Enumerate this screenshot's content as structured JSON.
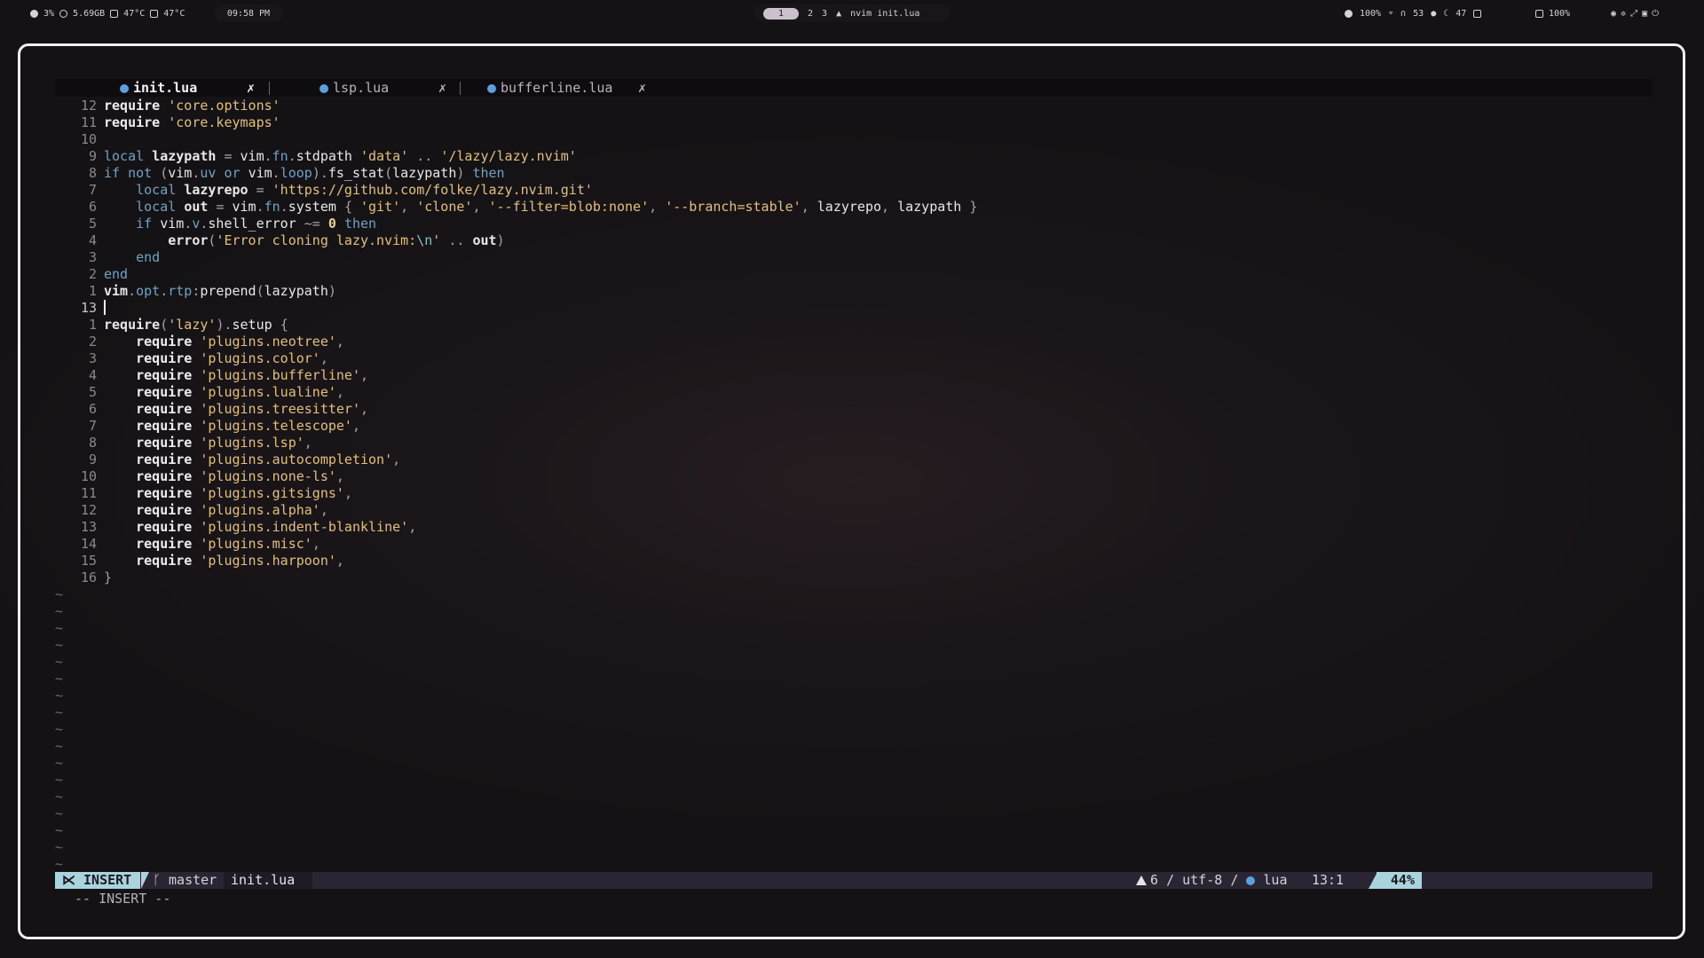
{
  "topbar": {
    "cpu": "3%",
    "mem": "5.69GB",
    "temp1": "47°C",
    "temp2": "47°C",
    "clock": "09:58 PM",
    "workspaces": [
      "1",
      "2",
      "3"
    ],
    "active_window": "nvim init.lua",
    "brightness": "100%",
    "volume": "53",
    "mic_value": "47",
    "battery": "100%"
  },
  "tabs": [
    {
      "label": "init.lua",
      "close": "✗",
      "active": true
    },
    {
      "label": "lsp.lua",
      "close": "✗",
      "active": false
    },
    {
      "label": "bufferline.lua",
      "close": "✗",
      "active": false
    }
  ],
  "line_numbers": [
    "12",
    "11",
    "10",
    "9",
    "8",
    "7",
    "6",
    "5",
    "4",
    "3",
    "2",
    "1",
    "13",
    "1",
    "2",
    "3",
    "4",
    "5",
    "6",
    "7",
    "8",
    "9",
    "10",
    "11",
    "12",
    "13",
    "14",
    "15",
    "16"
  ],
  "code": {
    "l0": [
      "require",
      "'core.options'"
    ],
    "l1": [
      "require",
      "'core.keymaps'"
    ],
    "l3": [
      "local",
      "lazypath",
      "=",
      "vim",
      ".",
      "fn",
      ".",
      "stdpath",
      "'data'",
      "..",
      "'/lazy/lazy.nvim'"
    ],
    "l4": [
      "if",
      "not",
      "(",
      "vim",
      ".",
      "uv",
      "or",
      "vim",
      ".",
      "loop",
      ").",
      "fs_stat",
      "(",
      "lazypath",
      ")",
      "then"
    ],
    "l5": [
      "local",
      "lazyrepo",
      "=",
      "'https://github.com/folke/lazy.nvim.git'"
    ],
    "l6": [
      "local",
      "out",
      "=",
      "vim",
      ".",
      "fn",
      ".",
      "system",
      "{",
      "'git'",
      ",",
      "'clone'",
      ",",
      "'--filter=blob:none'",
      ",",
      "'--branch=stable'",
      ",",
      "lazyrepo",
      ",",
      "lazypath",
      "}"
    ],
    "l7": [
      "if",
      "vim",
      ".",
      "v",
      ".",
      "shell_error",
      "~=",
      "0",
      "then"
    ],
    "l8": [
      "error",
      "(",
      "'Error cloning lazy.nvim:",
      "\\n",
      "'",
      "..",
      "out",
      ")"
    ],
    "l9": [
      "end"
    ],
    "l10": [
      "end"
    ],
    "l11": [
      "vim",
      ".",
      "opt",
      ".",
      "rtp",
      ":",
      "prepend",
      "(",
      "lazypath",
      ")"
    ],
    "l13": [
      "require",
      "(",
      "'lazy'",
      ").",
      "setup",
      "{"
    ],
    "plugins": [
      "'plugins.neotree'",
      "'plugins.color'",
      "'plugins.bufferline'",
      "'plugins.lualine'",
      "'plugins.treesitter'",
      "'plugins.telescope'",
      "'plugins.lsp'",
      "'plugins.autocompletion'",
      "'plugins.none-ls'",
      "'plugins.gitsigns'",
      "'plugins.alpha'",
      "'plugins.indent-blankline'",
      "'plugins.misc'",
      "'plugins.harpoon'"
    ],
    "plugin_keyword": "require",
    "comma": ",",
    "close_brace": "}"
  },
  "tilde": "~",
  "statusline": {
    "mode": "INSERT",
    "branch": "master",
    "filename": "init.lua",
    "warnings": "6",
    "encoding": "utf-8",
    "filetype": "lua",
    "sep": "/",
    "position": "13:1",
    "percent": "44%"
  },
  "cmdline": "-- INSERT --",
  "colors": {
    "keyword": "#6fa2c4",
    "string": "#e2c07c",
    "mode_bg": "#a9d4dd",
    "lua_icon": "#5b9fe0"
  }
}
